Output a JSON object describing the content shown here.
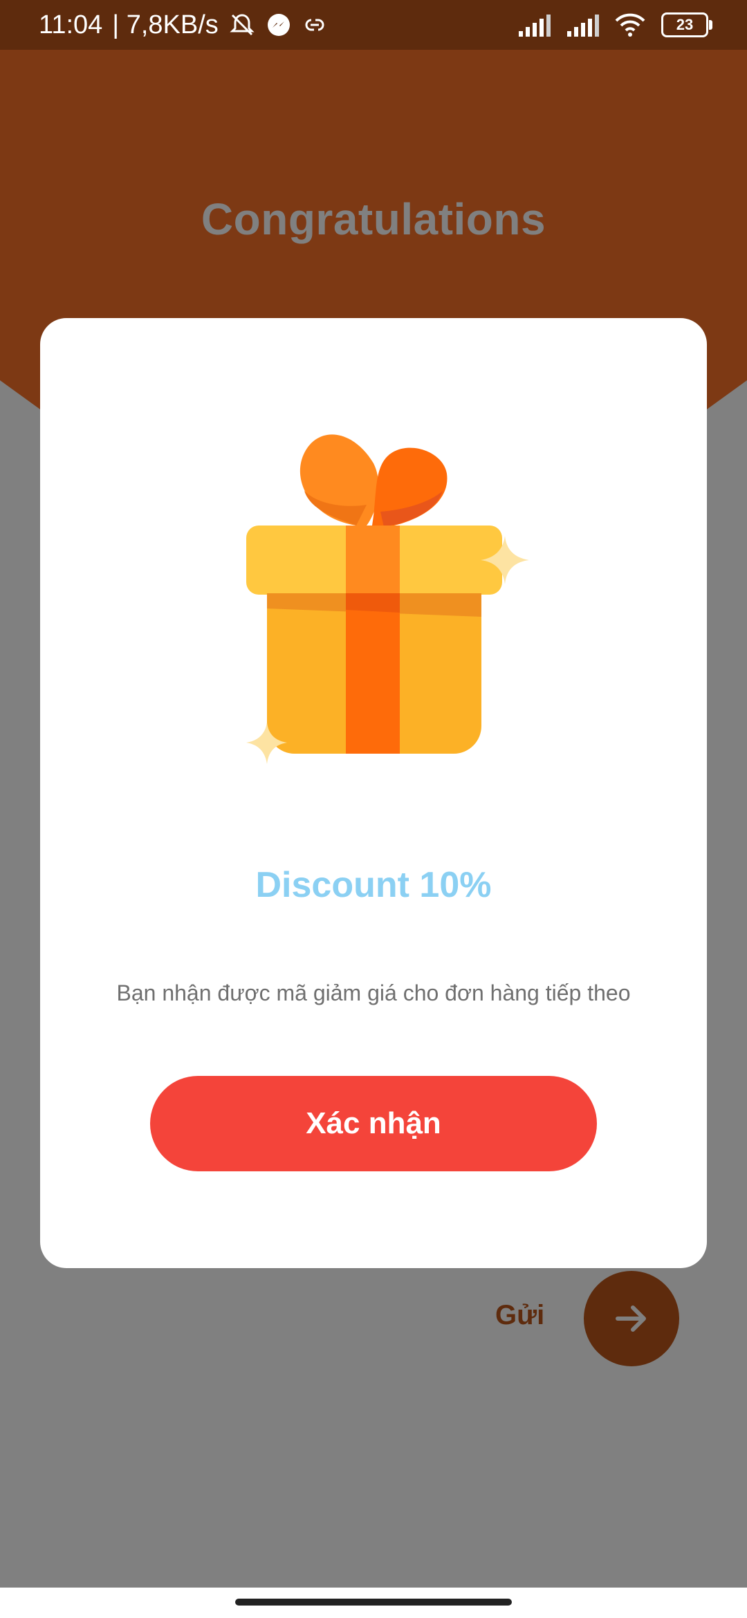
{
  "status_bar": {
    "time": "11:04",
    "network_speed": "| 7,8KB/s",
    "icons": [
      "mute-bell-icon",
      "messenger-icon",
      "link-icon",
      "signal-icon",
      "signal-icon",
      "wifi-icon"
    ],
    "battery": "23"
  },
  "header": {
    "title": "Congratulations"
  },
  "dialog": {
    "illustration": "gift-box-icon",
    "discount_title": "Discount 10%",
    "message": "Bạn nhận được mã giảm giá cho đơn hàng tiếp theo",
    "confirm_label": "Xác nhận"
  },
  "background_form": {
    "send_label": "Gửi",
    "send_icon": "arrow-right-icon"
  },
  "colors": {
    "header_brown": "#5e2b0d",
    "overlay_gray": "#808080",
    "confirm_red": "#f4443a",
    "discount_blue": "#8bd0f3"
  }
}
